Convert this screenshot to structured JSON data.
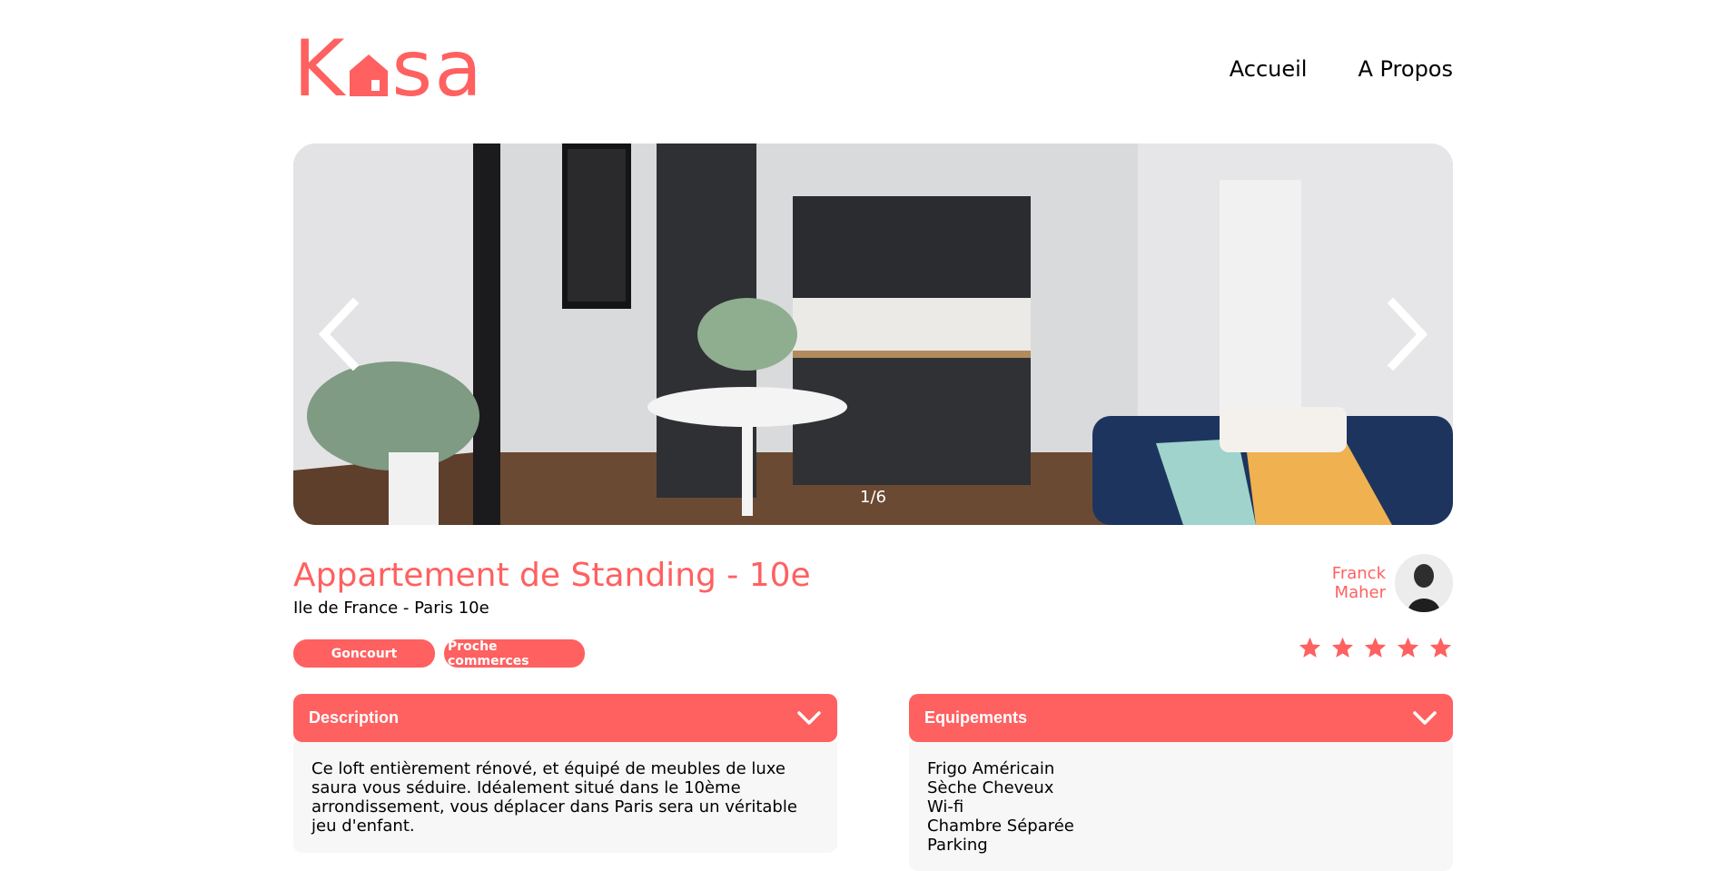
{
  "logo": {
    "text_start": "K",
    "text_end": "sa",
    "house_icon": "house-icon"
  },
  "nav": {
    "home": "Accueil",
    "about": "A Propos"
  },
  "carousel": {
    "counter": "1/6",
    "prev_icon": "chevron-left-icon",
    "next_icon": "chevron-right-icon"
  },
  "listing": {
    "title": "Appartement de Standing - 10e",
    "location": "Ile de France - Paris 10e",
    "tags": [
      "Goncourt",
      "Proche commerces"
    ]
  },
  "host": {
    "first_name": "Franck",
    "last_name": "Maher"
  },
  "rating": {
    "value": 5,
    "max": 5,
    "color_filled": "#FF6060"
  },
  "description": {
    "title": "Description",
    "text": "Ce loft entièrement rénové, et équipé de meubles de luxe saura vous séduire. Idéalement situé dans le 10ème arrondissement, vous déplacer dans Paris sera un véritable jeu d'enfant."
  },
  "equipements": {
    "title": "Equipements",
    "items": [
      "Frigo Américain",
      "Sèche Cheveux",
      "Wi-fi",
      "Chambre Séparée",
      "Parking"
    ]
  },
  "colors": {
    "accent": "#FF6060",
    "panel": "#F7F7F7"
  }
}
